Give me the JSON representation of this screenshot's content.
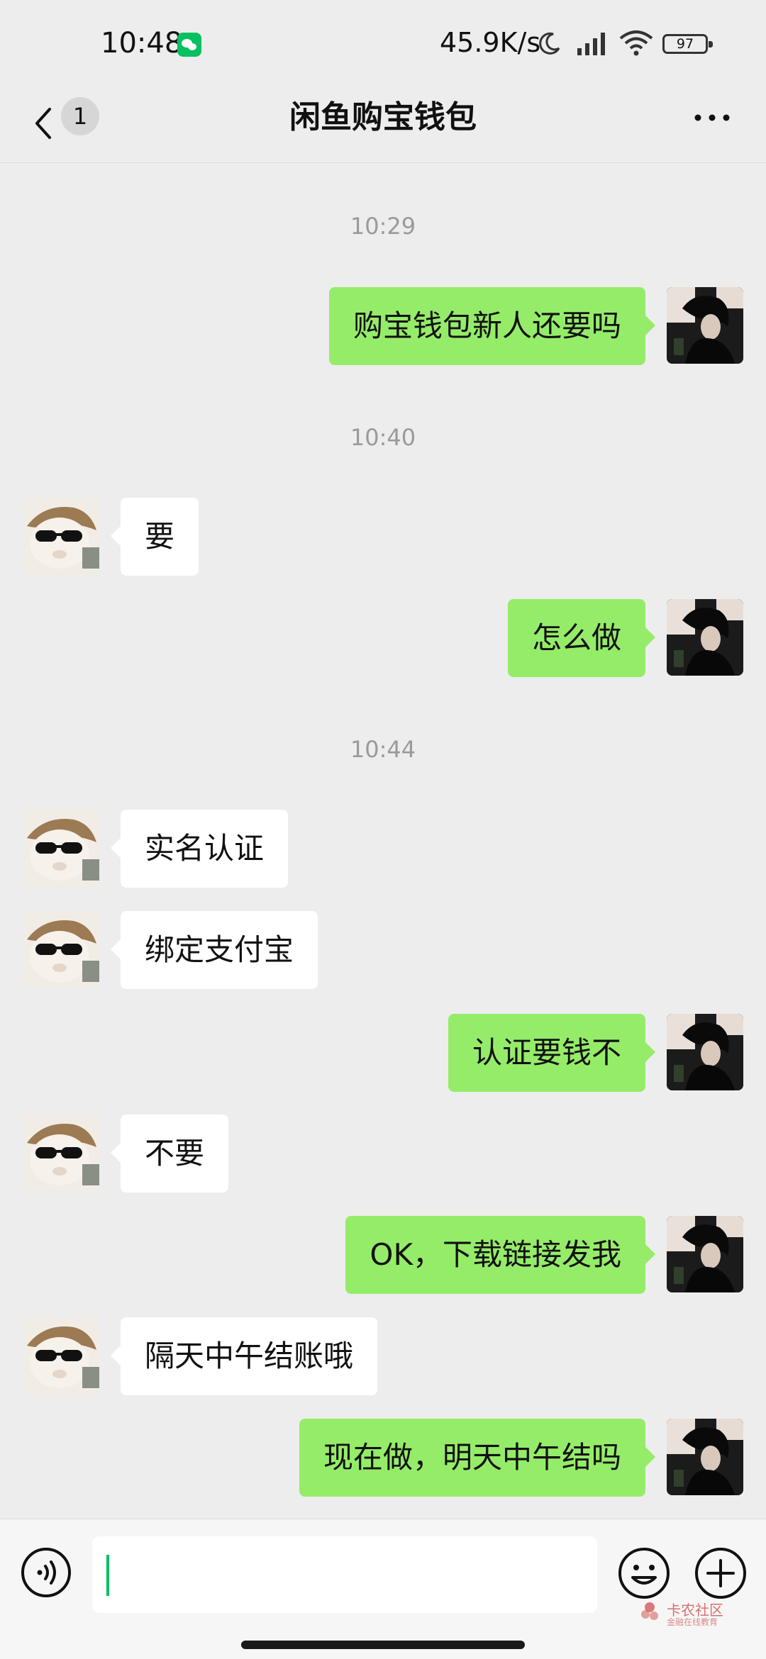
{
  "status_bar": {
    "time": "10:48",
    "network_speed": "45.9K/s",
    "battery": "97",
    "app_icon": "wechat-icon"
  },
  "nav": {
    "unread_count": "1",
    "title": "闲鱼购宝钱包",
    "back_icon": "chevron-left-icon",
    "more_icon": "more-dots-icon"
  },
  "messages": [
    {
      "type": "time",
      "text": "10:29"
    },
    {
      "type": "self",
      "text": "购宝钱包新人还要吗"
    },
    {
      "type": "time",
      "text": "10:40"
    },
    {
      "type": "other",
      "text": "要"
    },
    {
      "type": "self",
      "text": "怎么做"
    },
    {
      "type": "time",
      "text": "10:44"
    },
    {
      "type": "other",
      "text": "实名认证"
    },
    {
      "type": "other",
      "text": "绑定支付宝"
    },
    {
      "type": "self",
      "text": "认证要钱不"
    },
    {
      "type": "other",
      "text": "不要"
    },
    {
      "type": "self",
      "text": "OK，下载链接发我"
    },
    {
      "type": "other",
      "text": "隔天中午结账哦"
    },
    {
      "type": "self",
      "text": "现在做，明天中午结吗"
    }
  ],
  "input_bar": {
    "value": "",
    "voice_icon": "voice-icon",
    "emoji_icon": "emoji-icon",
    "plus_icon": "plus-icon"
  },
  "watermark": {
    "text": "卡农社区",
    "subtext": "金融在线教育"
  },
  "colors": {
    "background": "#ededed",
    "self_bubble": "#95ec69",
    "other_bubble": "#ffffff",
    "accent": "#07c160"
  }
}
